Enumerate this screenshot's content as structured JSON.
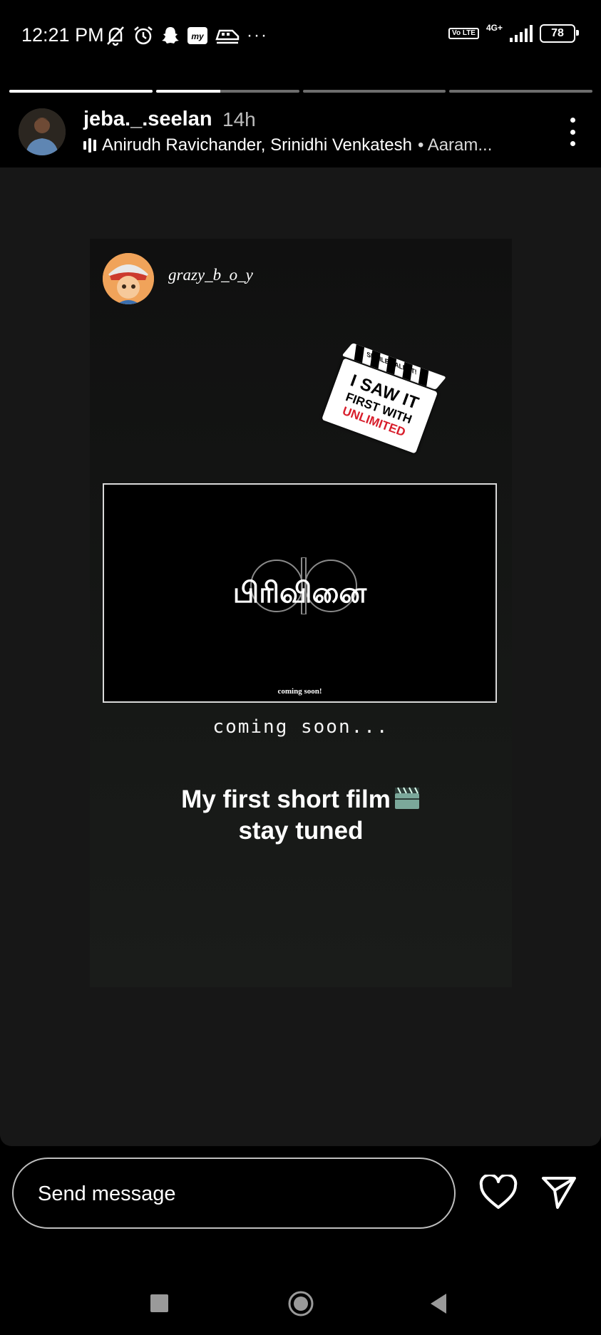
{
  "status_bar": {
    "time": "12:21 PM",
    "network": "4G+",
    "volte": "Vo LTE",
    "battery": "78"
  },
  "story": {
    "progress_segments": [
      1.0,
      0.45,
      0.0,
      0.0
    ],
    "username": "jeba._.seelan",
    "time_ago": "14h",
    "music_artists": "Anirudh Ravichander, Srinidhi Venkatesh",
    "music_track": "• Aaram..."
  },
  "reposted_post": {
    "username": "grazy_b_o_y",
    "sticker": {
      "top_label": "SPOILER ALERT!",
      "line1": "I SAW IT",
      "line2": "FIRST WITH",
      "line3": "UNLIMITED"
    },
    "poster_title": "பிரிவினை",
    "poster_subtitle": "coming soon!",
    "handwritten_text": "coming soon...",
    "caption_line1": "My first short film",
    "caption_line2": "stay tuned"
  },
  "footer": {
    "message_placeholder": "Send message"
  },
  "icons": {
    "status_left": [
      "bell-off-icon",
      "alarm-icon",
      "snapchat-icon",
      "app-icon",
      "train-icon",
      "more-dots-icon"
    ],
    "actions": [
      "heart-icon",
      "send-icon"
    ],
    "nav": [
      "recents-icon",
      "home-icon",
      "back-icon"
    ]
  }
}
